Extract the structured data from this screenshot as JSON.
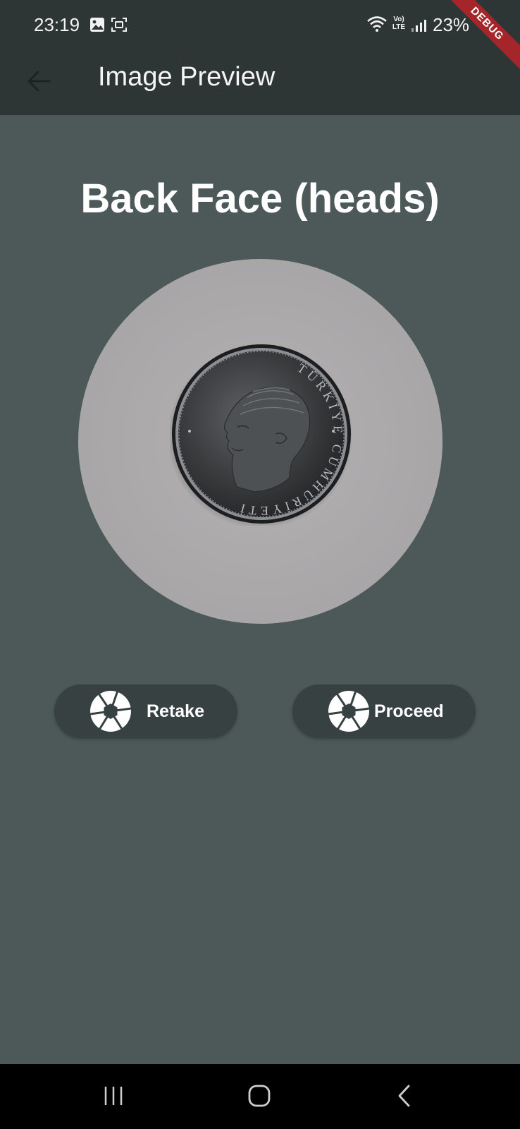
{
  "status_bar": {
    "time": "23:19",
    "battery": "23%",
    "volte_line1": "Vo)",
    "volte_line2": "LTE",
    "icons": [
      "gallery-icon",
      "screen-record-icon",
      "wifi-icon",
      "volte-icon",
      "signal-icon"
    ]
  },
  "app_bar": {
    "title": "Image Preview",
    "back_icon": "arrow-back-icon"
  },
  "debug_banner": "DEBUG",
  "main": {
    "heading": "Back Face (heads)",
    "preview_image": "coin-photo",
    "coin_inscription": "TÜRKİYE CUMHURİYETİ"
  },
  "actions": {
    "retake_label": "Retake",
    "proceed_label": "Proceed",
    "icon": "camera-shutter-icon"
  },
  "nav_bar": {
    "icons": [
      "recent-apps-icon",
      "home-icon",
      "back-icon"
    ]
  },
  "colors": {
    "background": "#4c5958",
    "app_bar": "#2e3535",
    "button": "#384141",
    "debug_ribbon": "#a5262a",
    "preview_circle": "#aeacad"
  }
}
